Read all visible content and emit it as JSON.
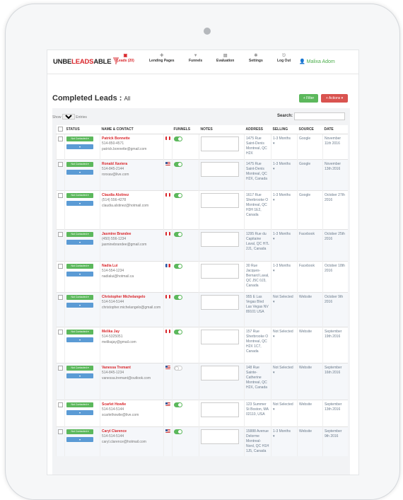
{
  "nav": {
    "logo": {
      "part1": "UNBE",
      "part2": "LEADS",
      "part3": "ABLE"
    },
    "items": [
      {
        "label": "Leads (20)",
        "icon": "inbox-icon"
      },
      {
        "label": "Lending Pages",
        "icon": "puzzle-icon"
      },
      {
        "label": "Funnels",
        "icon": "funnel-icon"
      },
      {
        "label": "Evaluation",
        "icon": "document-icon"
      },
      {
        "label": "Settings",
        "icon": "gear-icon"
      },
      {
        "label": "Log Out",
        "icon": "logout-icon"
      }
    ],
    "user": "Malixa Adom"
  },
  "page": {
    "title": "Completed Leads :",
    "title_sub": "All",
    "filter_label": "Filter",
    "actions_label": "Actions",
    "show_prefix": "Show",
    "show_value": "All",
    "show_suffix": "Entries",
    "search_label": "Search:"
  },
  "table": {
    "headers": [
      "",
      "STATUS",
      "NAME & CONTACT",
      "",
      "FUNNELS",
      "NOTES",
      "ADDRESS",
      "SELLING",
      "SOURCE",
      "DATE"
    ],
    "rows": [
      {
        "status": "Not Contacted",
        "name": "Patrick Bonnette",
        "phone": "514-850-4571",
        "email": "patrick.bonnette@gmail.com",
        "flag": "ca",
        "funnel": true,
        "address": "1475 Rue Saint-Denis Montreal, QC H2X",
        "selling": "1-3 Months",
        "source": "Google",
        "date": "November 11th 2016"
      },
      {
        "status": "Not Contacted",
        "name": "Ronald Xaviera",
        "phone": "514-845-2144",
        "email": "ronxav@live.com",
        "flag": "us",
        "funnel": true,
        "address": "1475 Rue Saint-Denis Montreal, QC H2X, Canada",
        "selling": "1-3 Months",
        "source": "Google",
        "date": "November 13th 2016"
      },
      {
        "status": "Not Contacted",
        "name": "Claudia Alstinez",
        "phone": "(514) 556-4278",
        "email": "claudia.alstinez@hotmail.com",
        "flag": "ca",
        "funnel": true,
        "address": "1617 Rue Sherbrooke O Montreal, QC H3H 1E2, Canada",
        "selling": "1-3 Months",
        "source": "Google",
        "date": "October 27th 2016"
      },
      {
        "status": "Not Contacted",
        "name": "Jasmine Brandee",
        "phone": "(450) 556-1234",
        "email": "jasminebrandee@gmail.com",
        "flag": "ca",
        "funnel": true,
        "address": "1295 Rue du Capitaine Laval, QC H7L 2J1, Canada",
        "selling": "1-3 Months",
        "source": "Facebook",
        "date": "October 25th 2016"
      },
      {
        "status": "Not Contacted",
        "name": "Nadia Lui",
        "phone": "514-554-1234",
        "email": "nadialui@hotmail.ca",
        "flag": "fr",
        "funnel": true,
        "address": "30 Rue Jacques-Bernard Laval, QC J5C 0J3, Canada",
        "selling": "1-3 Months",
        "source": "Facebook",
        "date": "October 18th 2016"
      },
      {
        "status": "Not Contacted",
        "name": "Christopher Michelangelo",
        "phone": "514-514-5144",
        "email": "christopher.michelangelo@gmail.com",
        "flag": "ca",
        "funnel": true,
        "address": "955 E Las Vegas Blvd Las Vegas NV 89101 USA",
        "selling": "Not Selected",
        "source": "Website",
        "date": "October 9th 2016"
      },
      {
        "status": "Not Contacted",
        "name": "Melika Jay",
        "phone": "514-5325051",
        "email": "melikajay@gmail.com",
        "flag": "ca",
        "funnel": true,
        "address": "157 Rue Sherbrooke O Montreal, QC H2X 1C7, Canada",
        "selling": "Not Selected",
        "source": "Website",
        "date": "September 19th 2016"
      },
      {
        "status": "Not Contacted",
        "name": "Vanessa Tremant",
        "phone": "514-845-1234",
        "email": "vanessa.tremant@outlook.com",
        "flag": "us",
        "funnel": false,
        "address": "148 Rue Sainte-Catherine Montreal, QC H2X, Canada",
        "selling": "Not Selected",
        "source": "Website",
        "date": "September 16th 2016"
      },
      {
        "status": "Not Contacted",
        "name": "Scarlet Howlie",
        "phone": "514-514-5144",
        "email": "scarlethowlie@live.com",
        "flag": "us",
        "funnel": true,
        "address": "123 Summer St Boston, MA 02110, USA",
        "selling": "Not Selected",
        "source": "Website",
        "date": "September 13th 2016"
      },
      {
        "status": "Not Contacted",
        "name": "Caryl Clarence",
        "phone": "514-514-5144",
        "email": "caryl.clarence@hotmail.com",
        "flag": "us",
        "funnel": true,
        "address": "15888 Avenue Delorme Montreal-Nord, QC H1H 1J5, Canada",
        "selling": "1-3 Months",
        "source": "Website",
        "date": "September 9th 2016"
      }
    ]
  }
}
